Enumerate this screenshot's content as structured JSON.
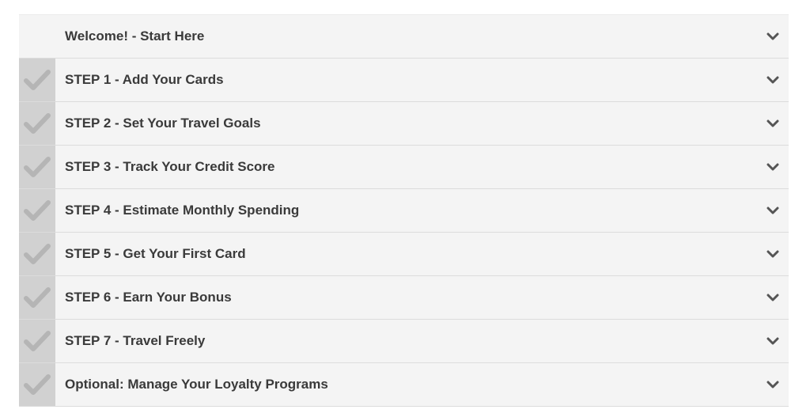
{
  "accordion": {
    "items": [
      {
        "label": "Welcome! - Start Here",
        "checked": false
      },
      {
        "label": "STEP 1 - Add Your Cards",
        "checked": true
      },
      {
        "label": "STEP 2 - Set Your Travel Goals",
        "checked": true
      },
      {
        "label": "STEP 3 - Track Your Credit Score",
        "checked": true
      },
      {
        "label": "STEP 4 - Estimate Monthly Spending",
        "checked": true
      },
      {
        "label": "STEP 5 - Get Your First Card",
        "checked": true
      },
      {
        "label": "STEP 6 - Earn Your Bonus",
        "checked": true
      },
      {
        "label": "STEP 7 - Travel Freely",
        "checked": true
      },
      {
        "label": "Optional: Manage Your Loyalty Programs",
        "checked": true
      }
    ]
  },
  "icons": {
    "check": "checkmark-icon",
    "expand": "chevron-down-icon"
  },
  "colors": {
    "row_bg": "#f4f4f4",
    "check_col_bg": "#d1d1d1",
    "check_mark": "#b5b5b5",
    "text": "#3a3a3a",
    "chevron": "#555555"
  }
}
